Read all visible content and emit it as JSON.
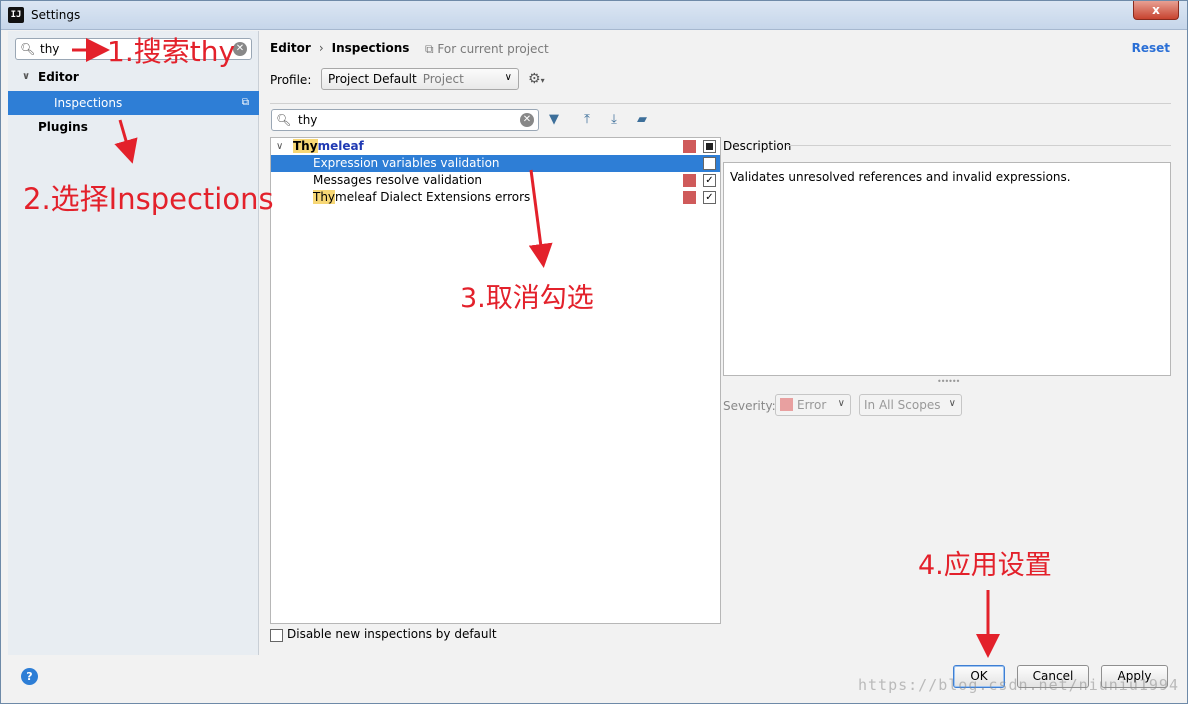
{
  "window": {
    "title": "Settings",
    "app_icon": "IJ",
    "close": "x"
  },
  "sidebar": {
    "search_value": "thy",
    "items": [
      {
        "label": "Editor"
      },
      {
        "label": "Inspections"
      },
      {
        "label": "Plugins"
      }
    ]
  },
  "header": {
    "crumb1": "Editor",
    "crumb2": "Inspections",
    "scope_note": "For current project",
    "reset": "Reset"
  },
  "profile": {
    "label": "Profile:",
    "value": "Project Default",
    "sub": "Project"
  },
  "inspections": {
    "search_value": "thy",
    "group": {
      "hl": "Thy",
      "rest": "meleaf"
    },
    "rows": [
      {
        "label": "Expression variables validation",
        "checked": false
      },
      {
        "label": "Messages resolve validation",
        "checked": true
      },
      {
        "hl": "Thy",
        "rest": "meleaf Dialect Extensions errors",
        "checked": true
      }
    ],
    "disable_label": "Disable new inspections by default"
  },
  "description": {
    "label": "Description",
    "text": "Validates unresolved references and invalid expressions."
  },
  "severity": {
    "label": "Severity:",
    "value": "Error",
    "scope": "In All Scopes"
  },
  "footer": {
    "help": "?",
    "ok": "OK",
    "cancel": "Cancel",
    "apply": "Apply"
  },
  "watermark": "https://blog.csdn.net/niuniu1994",
  "annotations": {
    "step1": "1.搜索thy",
    "step2": "2.选择Inspections",
    "step3": "3.取消勾选",
    "step4": "4.应用设置"
  },
  "colors": {
    "accent": "#2e7ed6",
    "annotation": "#e3212b",
    "severity": "#cf5a5a",
    "highlight": "#f7d775"
  }
}
